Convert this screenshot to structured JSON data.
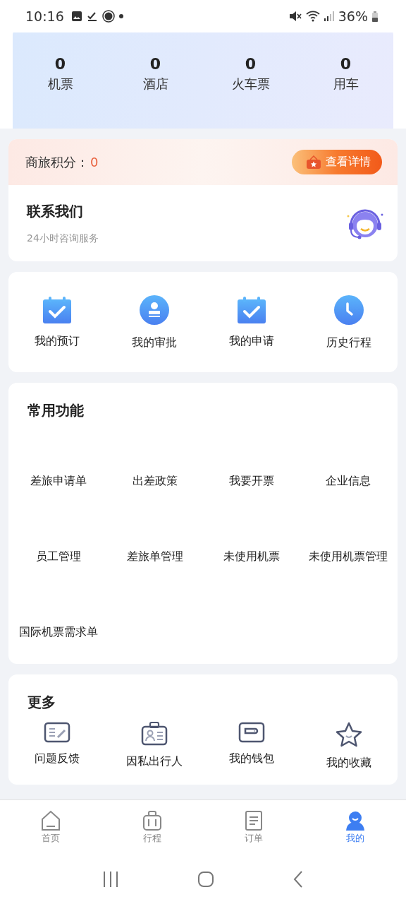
{
  "status_bar": {
    "time": "10:16",
    "battery": "36%"
  },
  "stats": [
    {
      "value": "0",
      "label": "机票"
    },
    {
      "value": "0",
      "label": "酒店"
    },
    {
      "value": "0",
      "label": "火车票"
    },
    {
      "value": "0",
      "label": "用车"
    }
  ],
  "points": {
    "label": "商旅积分：",
    "value": "0",
    "button": "查看详情"
  },
  "contact": {
    "title": "联系我们",
    "subtitle": "24小时咨询服务"
  },
  "quick_links": [
    {
      "label": "我的预订",
      "kind": "calendar"
    },
    {
      "label": "我的审批",
      "kind": "stamp"
    },
    {
      "label": "我的申请",
      "kind": "calendar"
    },
    {
      "label": "历史行程",
      "kind": "clock"
    }
  ],
  "common": {
    "title": "常用功能",
    "items": [
      "差旅申请单",
      "出差政策",
      "我要开票",
      "企业信息",
      "员工管理",
      "差旅单管理",
      "未使用机票",
      "未使用机票管理",
      "国际机票需求单"
    ]
  },
  "more": {
    "title": "更多",
    "items": [
      {
        "label": "问题反馈",
        "kind": "feedback"
      },
      {
        "label": "因私出行人",
        "kind": "badge"
      },
      {
        "label": "我的钱包",
        "kind": "wallet"
      },
      {
        "label": "我的收藏",
        "kind": "star"
      }
    ]
  },
  "tab_bar": [
    {
      "label": "首页",
      "kind": "home",
      "selected": false
    },
    {
      "label": "行程",
      "kind": "luggage",
      "selected": false
    },
    {
      "label": "订单",
      "kind": "order",
      "selected": false
    },
    {
      "label": "我的",
      "kind": "me",
      "selected": true
    }
  ]
}
